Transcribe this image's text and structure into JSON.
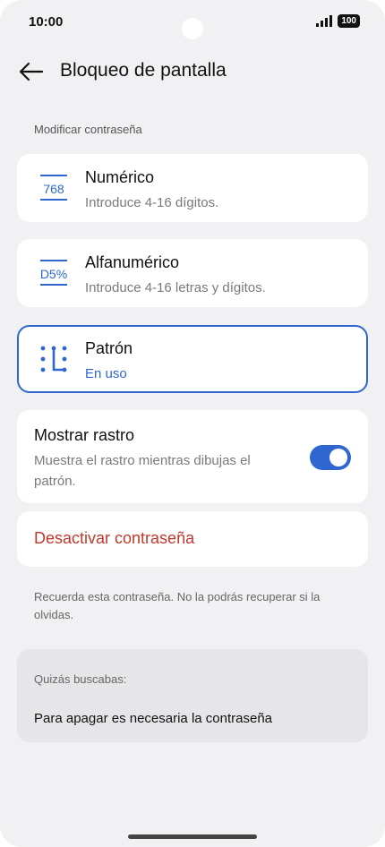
{
  "status": {
    "time": "10:00",
    "battery": "100"
  },
  "header": {
    "title": "Bloqueo de pantalla"
  },
  "section_label": "Modificar contraseña",
  "options": [
    {
      "title": "Numérico",
      "subtitle": "Introduce 4-16 dígitos.",
      "icon_text": "768",
      "icon": "numeric-icon"
    },
    {
      "title": "Alfanumérico",
      "subtitle": "Introduce 4-16 letras y dígitos.",
      "icon_text": "D5%",
      "icon": "alphanumeric-icon"
    },
    {
      "title": "Patrón",
      "subtitle": "En uso",
      "icon": "pattern-icon",
      "selected": true
    }
  ],
  "trace": {
    "title": "Mostrar rastro",
    "subtitle": "Muestra el rastro mientras dibujas el patrón.",
    "enabled": true
  },
  "disable_label": "Desactivar contraseña",
  "note": "Recuerda esta contraseña. No la podrás recuperar si la olvidas.",
  "suggestions": {
    "label": "Quizás buscabas:",
    "item": "Para apagar es necesaria la contraseña"
  },
  "colors": {
    "accent": "#2f66d0",
    "danger": "#c0392b",
    "background": "#f1f1f3"
  }
}
